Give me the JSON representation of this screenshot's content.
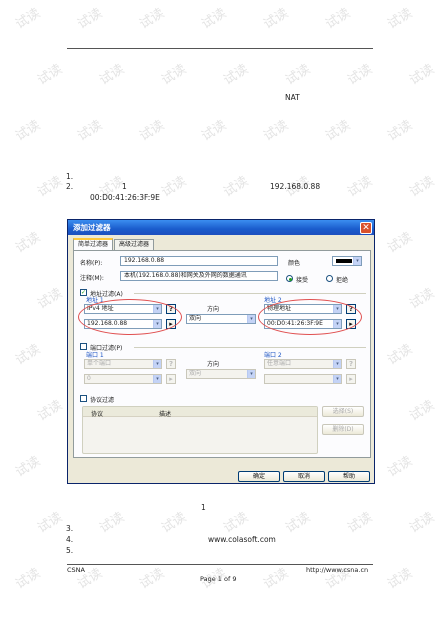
{
  "page": {
    "nat": "NAT",
    "step1": "1.",
    "step2_num": "2.",
    "step2_mid": "1",
    "step2_ip": "192.168.0.88",
    "step2_mac": "00:D0:41:26:3F:9E",
    "caption": "1",
    "step3": "3.",
    "step4_num": "4.",
    "step4_url": "www.colasoft.com",
    "step5": "5."
  },
  "footer": {
    "left": "CSNA",
    "right": "http://www.csna.cn",
    "page": "Page 1 of 9"
  },
  "watermark": {
    "text": "试读"
  },
  "dialog": {
    "title": "添加过滤器",
    "close": "✕",
    "tabs": [
      "简单过滤器",
      "高级过滤器"
    ],
    "name_label": "名称(P):",
    "name_value": "192.168.0.88",
    "color_label": "颜色",
    "comment_label": "注释(M):",
    "comment_value": "本机(192.168.0.88)和网关及外网的数据通讯",
    "accept_label": "接受",
    "reject_label": "拒绝",
    "address": {
      "checkbox_label": "地址过滤(A)",
      "addr1_label": "地址 1",
      "addr1_type": "IPv4 地址",
      "addr1_value": "192.168.0.88",
      "direction_label": "方向",
      "direction_value": "双向",
      "addr2_label": "地址 2",
      "addr2_type": "物理地址",
      "addr2_value": "00:D0:41:26:3F:9E"
    },
    "port": {
      "checkbox_label": "端口过滤(P)",
      "port1_label": "端口 1",
      "port1_type": "单个端口",
      "port1_value": "0",
      "direction_label": "方向",
      "direction_value": "双向",
      "port2_label": "端口 2",
      "port2_type": "任意端口"
    },
    "protocol": {
      "checkbox_label": "协议过滤",
      "columns": [
        "协议",
        "描述"
      ],
      "select_button": "选择(S)",
      "delete_button": "删除(D)"
    },
    "buttons": {
      "ok": "确定",
      "cancel": "取消",
      "help": "帮助"
    },
    "icons": {
      "help": "?",
      "arrow": "▸",
      "dropdown": "▾"
    },
    "colors": {
      "titlebar": "#1d5ccc",
      "highlight_oval": "#e05050",
      "checkmark": "#21a121"
    }
  }
}
